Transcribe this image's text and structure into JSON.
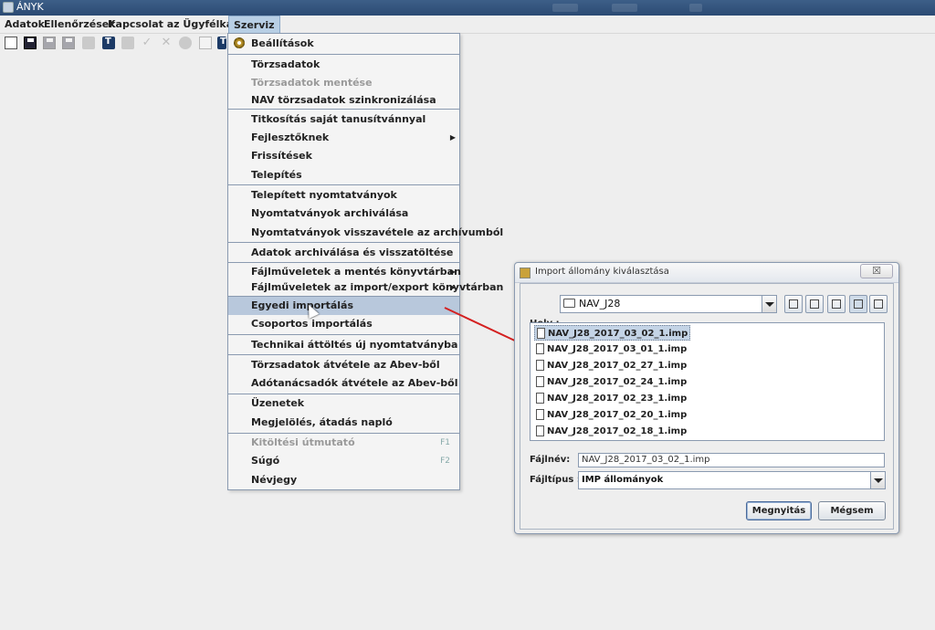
{
  "window": {
    "title": "ÁNYK"
  },
  "menubar": {
    "items": [
      "Adatok",
      "Ellenőrzések",
      "Kapcsolat az Ügyfélkapuval",
      "Szerviz"
    ],
    "active": "Szerviz"
  },
  "toolbar": {
    "icons": [
      "copy-icon",
      "save-icon",
      "save-disabled-icon",
      "save-all-disabled-icon",
      "print-disabled-icon",
      "book-icon",
      "printer-icon",
      "check-icon",
      "delete-icon",
      "shield-icon",
      "mail-icon",
      "book2-icon"
    ]
  },
  "menu": {
    "items": [
      {
        "label": "Beállítások",
        "icon": "gear-icon"
      },
      {
        "label": "Törzsadatok"
      },
      {
        "label": "Törzsadatok mentése",
        "disabled": true
      },
      {
        "label": "NAV törzsadatok szinkronizálása"
      },
      {
        "label": "Titkosítás saját tanusítvánnyal"
      },
      {
        "label": "Fejlesztőknek",
        "submenu": true
      },
      {
        "label": "Frissítések"
      },
      {
        "label": "Telepítés"
      },
      {
        "label": "Telepített nyomtatványok"
      },
      {
        "label": "Nyomtatványok archiválása"
      },
      {
        "label": "Nyomtatványok visszavétele az archívumból"
      },
      {
        "label": "Adatok archiválása és visszatöltése"
      },
      {
        "label": "Fájlműveletek a mentés könyvtárban",
        "submenu": true
      },
      {
        "label": "Fájlműveletek az import/export könyvtárban",
        "submenu": true
      },
      {
        "label": "Egyedi importálás",
        "highlighted": true
      },
      {
        "label": "Csoportos importálás"
      },
      {
        "label": "Technikai áttöltés új nyomtatványba"
      },
      {
        "label": "Törzsadatok átvétele az Abev-ből"
      },
      {
        "label": "Adótanácsadók átvétele az Abev-ből"
      },
      {
        "label": "Üzenetek"
      },
      {
        "label": "Megjelölés, átadás napló"
      },
      {
        "label": "Kitöltési útmutató",
        "disabled": true,
        "shortcut": "F1"
      },
      {
        "label": "Súgó",
        "shortcut": "F2"
      },
      {
        "label": "Névjegy"
      }
    ]
  },
  "dialog": {
    "title": "Import állomány kiválasztása",
    "close_label": "☒",
    "location_label": "Hely :",
    "location_value": "NAV_J28",
    "files": [
      "NAV_J28_2017_03_02_1.imp",
      "NAV_J28_2017_03_01_1.imp",
      "NAV_J28_2017_02_27_1.imp",
      "NAV_J28_2017_02_24_1.imp",
      "NAV_J28_2017_02_23_1.imp",
      "NAV_J28_2017_02_20_1.imp",
      "NAV_J28_2017_02_18_1.imp"
    ],
    "selected_file": "NAV_J28_2017_03_02_1.imp",
    "filename_label": "Fájlnév:",
    "filename_value": "NAV_J28_2017_03_02_1.imp",
    "filetype_label": "Fájltípus :",
    "filetype_value": "IMP állományok",
    "open_button": "Megnyitás",
    "cancel_button": "Mégsem"
  },
  "colors": {
    "titlebar": "#2b4a73",
    "menu_highlight": "#b8c8dc",
    "annotation_arrow": "#d42020"
  }
}
